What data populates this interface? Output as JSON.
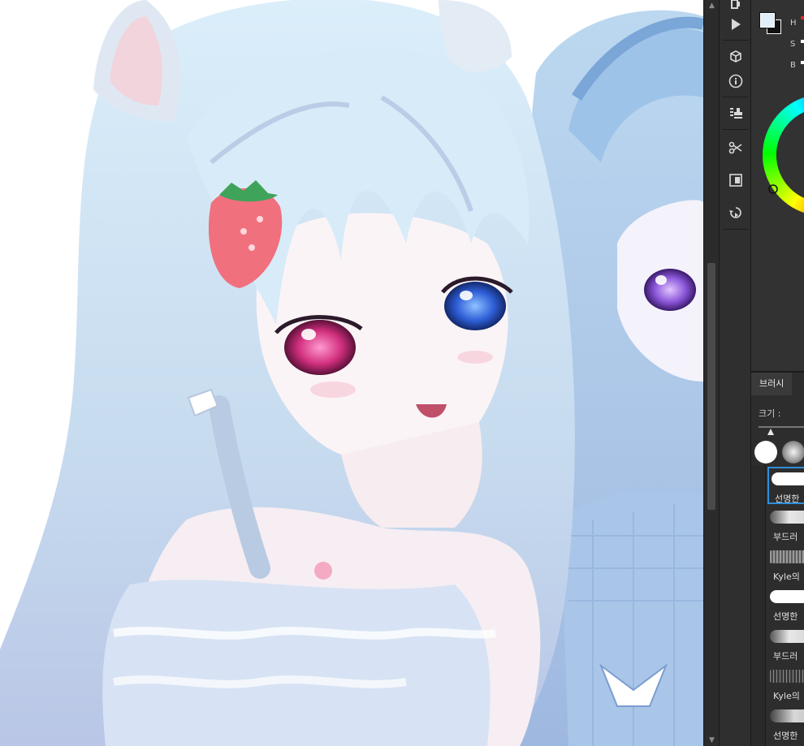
{
  "color_panel": {
    "h_label": "H",
    "s_label": "S",
    "b_label": "B",
    "foreground_color": "#dfeef8",
    "background_color": "#111111"
  },
  "brush_panel": {
    "tab_label": "브러시",
    "size_label": "크기 :",
    "tips": [
      "hard-round-tip",
      "soft-round-tip"
    ],
    "brushes": [
      {
        "label": "선명한"
      },
      {
        "label": "부드러"
      },
      {
        "label": "Kyle의"
      },
      {
        "label": "선명한"
      },
      {
        "label": "부드러"
      },
      {
        "label": "Kyle의"
      },
      {
        "label": "선명한"
      }
    ]
  },
  "toolbar": {
    "tools": [
      "brush-settings-icon",
      "play-icon",
      "3d-cube-icon",
      "info-icon",
      "stamp-icon",
      "scissors-icon",
      "layer-comp-icon",
      "history-icon"
    ]
  },
  "colors": {
    "accent": "#2f8ed8",
    "panel_bg": "#323232",
    "tool_bg": "#2f2f2f"
  }
}
